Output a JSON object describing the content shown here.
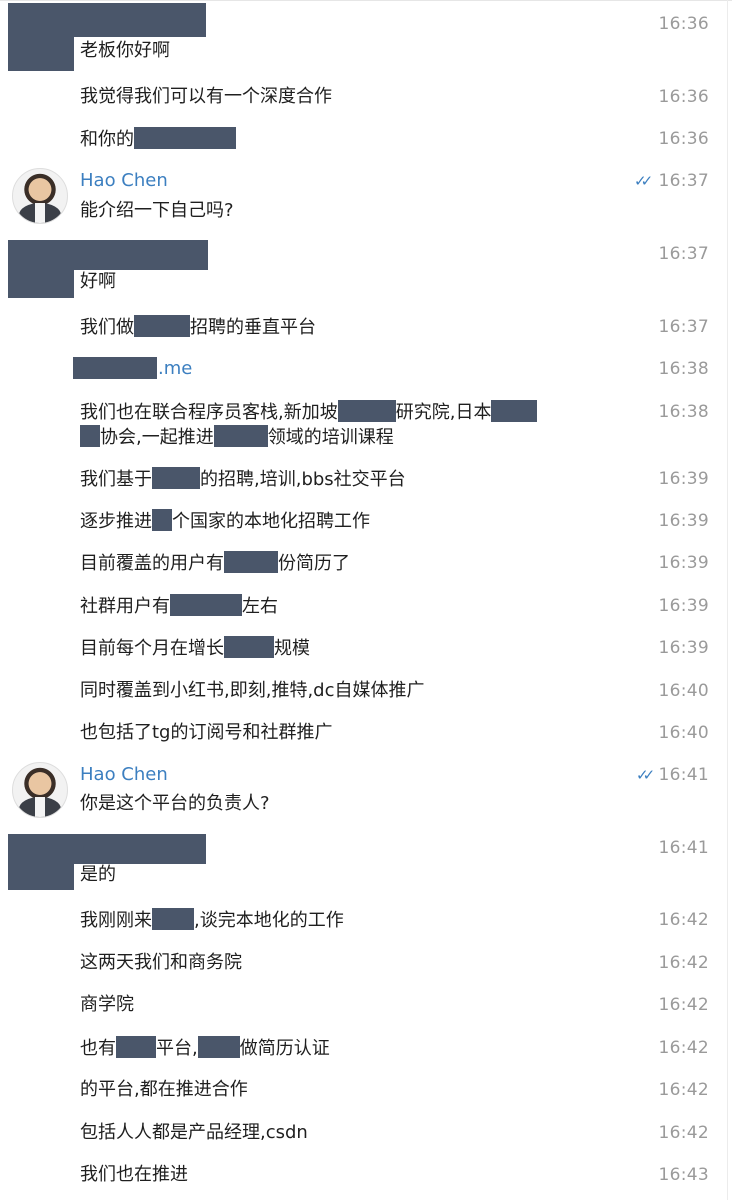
{
  "messages": [
    {
      "text": "老板你好啊",
      "time": "16:36"
    },
    {
      "text": "我觉得我们可以有一个深度合作",
      "time": "16:36"
    },
    {
      "text": "和你的",
      "time": "16:36"
    },
    {
      "sender": "Hao Chen",
      "text": "能介绍一下自己吗?",
      "time": "16:37"
    },
    {
      "text": "好啊",
      "time": "16:37"
    },
    {
      "text_a": "我们做",
      "text_b": "招聘的垂直平台",
      "time": "16:37"
    },
    {
      "link": ".me",
      "time": "16:38"
    },
    {
      "line1_a": "我们也在联合程序员客栈,新加坡",
      "line1_b": "研究院,日本",
      "line2_b": "协会,一起推进",
      "line2_c": "领域的培训课程",
      "time": "16:38"
    },
    {
      "text_a": "我们基于",
      "text_b": "的招聘,培训,bbs社交平台",
      "time": "16:39"
    },
    {
      "text_a": "逐步推进",
      "text_b": "个国家的本地化招聘工作",
      "time": "16:39"
    },
    {
      "text_a": "目前覆盖的用户有",
      "text_b": "份简历了",
      "time": "16:39"
    },
    {
      "text_a": "社群用户有",
      "text_b": "左右",
      "time": "16:39"
    },
    {
      "text_a": "目前每个月在增长",
      "text_b": "规模",
      "time": "16:39"
    },
    {
      "text": "同时覆盖到小红书,即刻,推特,dc自媒体推广",
      "time": "16:40"
    },
    {
      "text": "也包括了tg的订阅号和社群推广",
      "time": "16:40"
    },
    {
      "sender": "Hao Chen",
      "text": "你是这个平台的负责人?",
      "time": "16:41"
    },
    {
      "text": "是的",
      "time": "16:41"
    },
    {
      "text_a": "我刚刚来",
      "text_b": ",谈完本地化的工作",
      "time": "16:42"
    },
    {
      "text": "这两天我们和商务院",
      "time": "16:42"
    },
    {
      "text": "商学院",
      "time": "16:42"
    },
    {
      "text_a": "也有",
      "text_b": "平台,",
      "text_c": "做简历认证",
      "time": "16:42"
    },
    {
      "text": "的平台,都在推进合作",
      "time": "16:42"
    },
    {
      "text": "包括人人都是产品经理,csdn",
      "time": "16:42"
    },
    {
      "text": "我们也在推进",
      "time": "16:43"
    }
  ],
  "read_icon": "double-check-icon"
}
